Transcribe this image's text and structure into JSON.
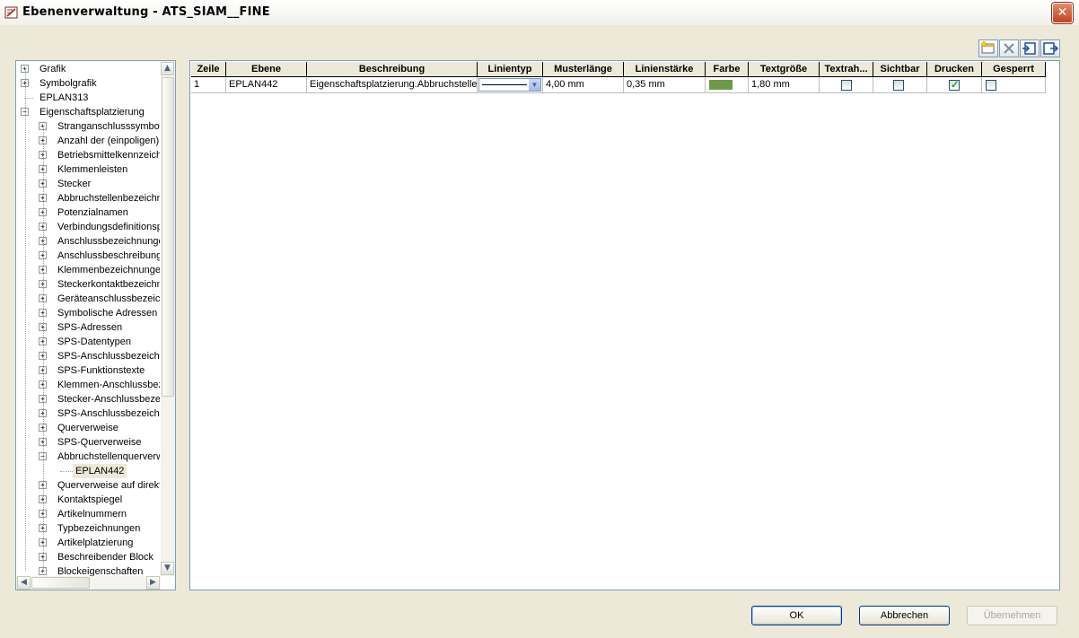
{
  "window": {
    "title": "Ebenenverwaltung - ATS_SIAM__FINE",
    "close_glyph": "✕"
  },
  "toolbar": {
    "icons": [
      "new-layer-icon",
      "delete-layer-icon",
      "import-icon",
      "export-icon"
    ]
  },
  "tree": {
    "items": [
      {
        "label": "Grafik",
        "level": 0,
        "expander": "+"
      },
      {
        "label": "Symbolgrafik",
        "level": 0,
        "expander": "+"
      },
      {
        "label": "EPLAN313",
        "level": 0,
        "expander": ""
      },
      {
        "label": "Eigenschaftsplatzierung",
        "level": 0,
        "expander": "-"
      },
      {
        "label": "Stranganschlusssymbole",
        "level": 1,
        "expander": "+"
      },
      {
        "label": "Anzahl der (einpoligen) Darstellungen",
        "level": 1,
        "expander": "+"
      },
      {
        "label": "Betriebsmittelkennzeichen",
        "level": 1,
        "expander": "+"
      },
      {
        "label": "Klemmenleisten",
        "level": 1,
        "expander": "+"
      },
      {
        "label": "Stecker",
        "level": 1,
        "expander": "+"
      },
      {
        "label": "Abbruchstellenbezeichnungen",
        "level": 1,
        "expander": "+"
      },
      {
        "label": "Potenzialnamen",
        "level": 1,
        "expander": "+"
      },
      {
        "label": "Verbindungsdefinitionspunkte",
        "level": 1,
        "expander": "+"
      },
      {
        "label": "Anschlussbezeichnungen",
        "level": 1,
        "expander": "+"
      },
      {
        "label": "Anschlussbeschreibungen",
        "level": 1,
        "expander": "+"
      },
      {
        "label": "Klemmenbezeichnungen",
        "level": 1,
        "expander": "+"
      },
      {
        "label": "Steckerkontaktbezeichnungen",
        "level": 1,
        "expander": "+"
      },
      {
        "label": "Geräteanschlussbezeichnungen",
        "level": 1,
        "expander": "+"
      },
      {
        "label": "Symbolische Adressen",
        "level": 1,
        "expander": "+"
      },
      {
        "label": "SPS-Adressen",
        "level": 1,
        "expander": "+"
      },
      {
        "label": "SPS-Datentypen",
        "level": 1,
        "expander": "+"
      },
      {
        "label": "SPS-Anschlussbezeichnungen",
        "level": 1,
        "expander": "+"
      },
      {
        "label": "SPS-Funktionstexte",
        "level": 1,
        "expander": "+"
      },
      {
        "label": "Klemmen-Anschlussbezeichnungen",
        "level": 1,
        "expander": "+"
      },
      {
        "label": "Stecker-Anschlussbezeichnungen",
        "level": 1,
        "expander": "+"
      },
      {
        "label": "SPS-Anschlussbezeichnungen",
        "level": 1,
        "expander": "+"
      },
      {
        "label": "Querverweise",
        "level": 1,
        "expander": "+"
      },
      {
        "label": "SPS-Querverweise",
        "level": 1,
        "expander": "+"
      },
      {
        "label": "Abbruchstellenquerverweise",
        "level": 1,
        "expander": "-"
      },
      {
        "label": "EPLAN442",
        "level": 2,
        "expander": "",
        "selected": true
      },
      {
        "label": "Querverweise auf direkte Abbruchstellen",
        "level": 1,
        "expander": "+"
      },
      {
        "label": "Kontaktspiegel",
        "level": 1,
        "expander": "+"
      },
      {
        "label": "Artikelnummern",
        "level": 1,
        "expander": "+"
      },
      {
        "label": "Typbezeichnungen",
        "level": 1,
        "expander": "+"
      },
      {
        "label": "Artikelplatzierung",
        "level": 1,
        "expander": "+"
      },
      {
        "label": "Beschreibender Block",
        "level": 1,
        "expander": "+"
      },
      {
        "label": "Blockeigenschaften",
        "level": 1,
        "expander": "+"
      }
    ]
  },
  "grid": {
    "columns": [
      "Zeile",
      "Ebene",
      "Beschreibung",
      "Linientyp",
      "Musterlänge",
      "Linienstärke",
      "Farbe",
      "Textgröße",
      "Textrah...",
      "Sichtbar",
      "Drucken",
      "Gesperrt"
    ],
    "rows": [
      {
        "zeile": "1",
        "ebene": "EPLAN442",
        "beschreibung": "Eigenschaftsplatzierung.Abbruchstelle",
        "linientyp": "solid",
        "musterlaenge": "4,00 mm",
        "linienstaerke": "0,35 mm",
        "farbe": "#6e9a48",
        "textgroesse": "1,80 mm",
        "textrahmen": false,
        "sichtbar": false,
        "drucken": true,
        "gesperrt": false
      }
    ]
  },
  "buttons": {
    "ok": "OK",
    "cancel": "Abbrechen",
    "apply": "Übernehmen"
  }
}
